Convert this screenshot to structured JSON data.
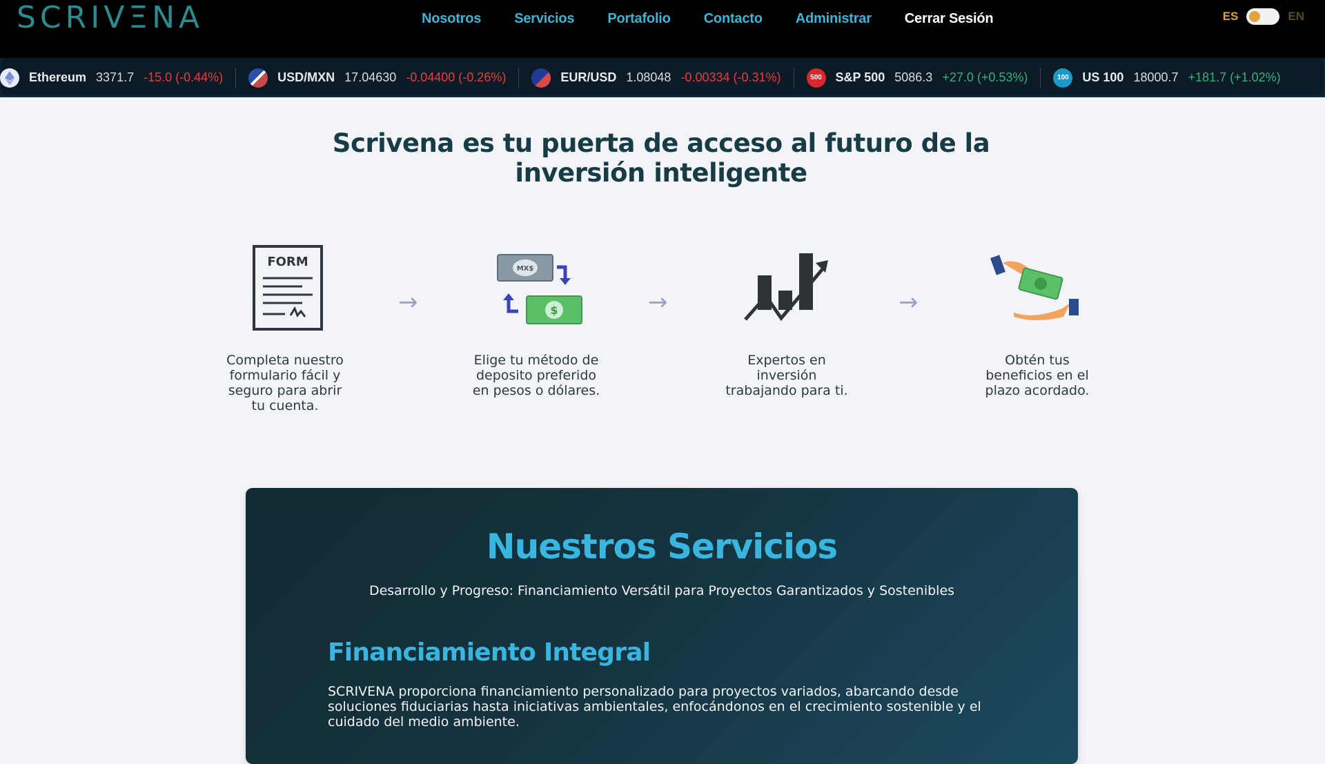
{
  "brand": {
    "logo": "SCRIVΞNA"
  },
  "nav": {
    "links": [
      "Nosotros",
      "Servicios",
      "Portafolio",
      "Contacto",
      "Administrar"
    ],
    "logout": "Cerrar Sesión"
  },
  "lang": {
    "es": "ES",
    "en": "EN",
    "selected": "ES"
  },
  "ticker": [
    {
      "name": "Ethereum",
      "value": "3371.7",
      "change": "-15.0 (-0.44%)",
      "direction": "down",
      "icon": "ethereum-icon",
      "color": "#e8ecf5"
    },
    {
      "name": "USD/MXN",
      "value": "17.04630",
      "change": "-0.04400 (-0.26%)",
      "direction": "down",
      "icon": "us-mx-flag-icon",
      "color": "#c94a4a"
    },
    {
      "name": "EUR/USD",
      "value": "1.08048",
      "change": "-0.00334 (-0.31%)",
      "direction": "down",
      "icon": "eu-us-flag-icon",
      "color": "#2a4fa8"
    },
    {
      "name": "S&P 500",
      "value": "5086.3",
      "change": "+27.0 (+0.53%)",
      "direction": "up",
      "icon": "sp500-icon",
      "badge": "500",
      "color": "#d8282d"
    },
    {
      "name": "US 100",
      "value": "18000.7",
      "change": "+181.7 (+1.02%)",
      "direction": "up",
      "icon": "us100-icon",
      "badge": "100",
      "color": "#1a9ac8"
    }
  ],
  "hero": {
    "title": "Scrivena es tu puerta de acceso al futuro de la inversión inteligente"
  },
  "steps": [
    {
      "icon": "form-icon",
      "icon_label": "FORM",
      "text": "Completa nuestro formulario fácil y seguro para abrir tu cuenta."
    },
    {
      "icon": "currency-exchange-icon",
      "icon_label": "MX$",
      "text": "Elige tu método de deposito preferido en pesos o dólares."
    },
    {
      "icon": "chart-growth-icon",
      "text": "Expertos en inversión trabajando para ti."
    },
    {
      "icon": "money-hand-icon",
      "text": "Obtén tus beneficios en el plazo acordado."
    }
  ],
  "services": {
    "title": "Nuestros Servicios",
    "subtitle": "Desarrollo y Progreso: Financiamiento Versátil para Proyectos Garantizados y Sostenibles",
    "item_title": "Financiamiento Integral",
    "item_text": "SCRIVENA proporciona financiamiento personalizado para proyectos variados, abarcando desde soluciones fiduciarias hasta iniciativas ambientales, enfocándonos en el crecimiento sostenible y el cuidado del medio ambiente."
  },
  "colors": {
    "accent": "#38b6e0",
    "navbar": "#000000",
    "negative": "#e2403f",
    "positive": "#2fb37a"
  }
}
